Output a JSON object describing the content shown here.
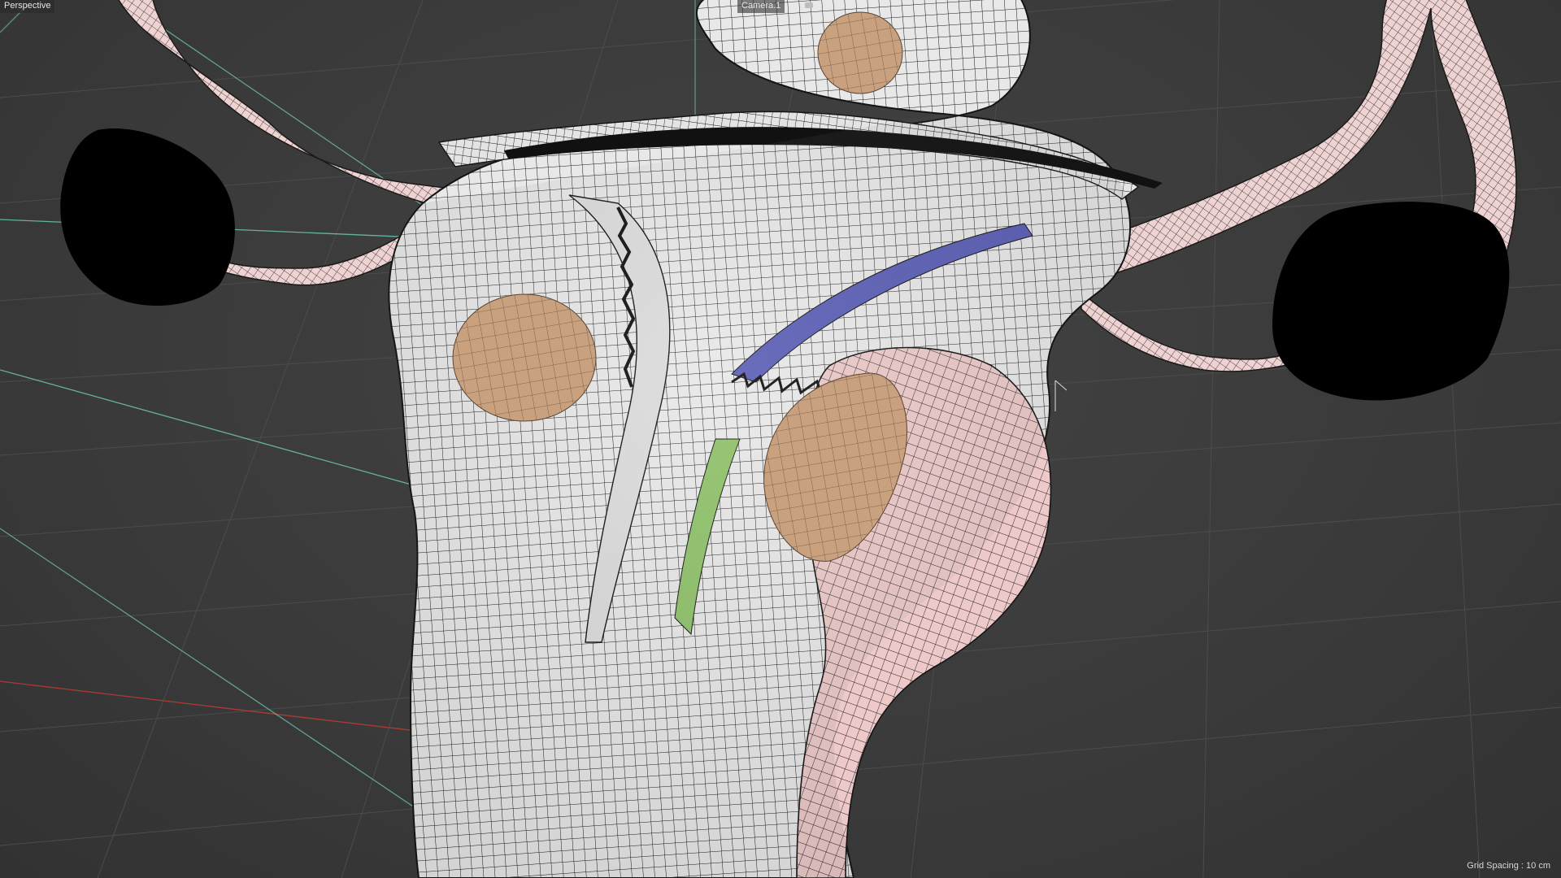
{
  "viewport": {
    "view_name": "Perspective",
    "camera_name": "Camera.1",
    "grid_spacing": "Grid Spacing : 10 cm"
  },
  "colors": {
    "background": "#3c3c3c",
    "grid_line": "#4c4c4c",
    "axis_x": "#b03a32",
    "axis_y": "#6fd0b8",
    "mesh_fill": "#e6e6e6",
    "mesh_wire": "#141414",
    "mesh_pink": "#ecc4c4",
    "ovary": "#000000",
    "fibroid": "#c7a07e",
    "green_layer": "#8fc26a",
    "blue_layer": "#5b5fb5"
  },
  "icons": [
    "camera-icon"
  ]
}
